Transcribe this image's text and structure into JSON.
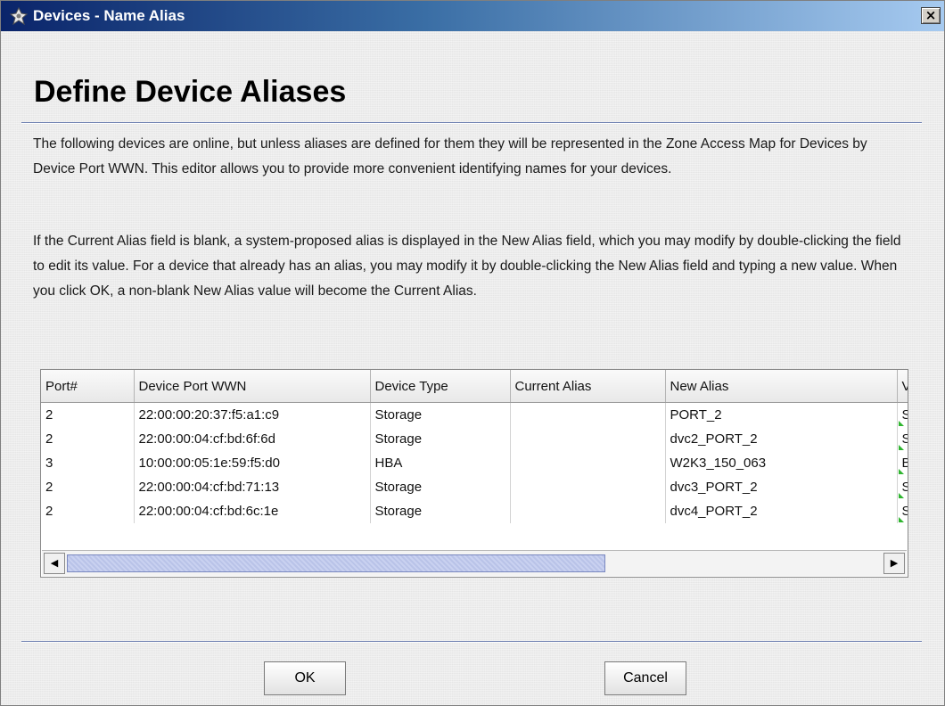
{
  "window": {
    "title": "Devices - Name Alias",
    "close_label": "×"
  },
  "heading": "Define Device Aliases",
  "paragraphs": [
    "The following devices are online, but unless aliases are defined for them they will be represented in the Zone Access Map for Devices by Device Port WWN. This editor allows you to provide more convenient identifying names for your devices.",
    "If the Current Alias field is blank, a system-proposed alias is displayed in the New Alias field, which you may modify by double-clicking the field to edit its value. For a device that already has an alias, you may modify it by double-clicking the New Alias field and typing a new value. When you click OK, a non-blank New Alias value will become the Current Alias."
  ],
  "table": {
    "columns": [
      "Port#",
      "Device Port WWN",
      "Device Type",
      "Current Alias",
      "New Alias",
      "V"
    ],
    "rows": [
      [
        "2",
        "22:00:00:20:37:f5:a1:c9",
        "Storage",
        "",
        "PORT_2",
        "S"
      ],
      [
        "2",
        "22:00:00:04:cf:bd:6f:6d",
        "Storage",
        "",
        "dvc2_PORT_2",
        "S"
      ],
      [
        "3",
        "10:00:00:05:1e:59:f5:d0",
        "HBA",
        "",
        "W2K3_150_063",
        "B"
      ],
      [
        "2",
        "22:00:00:04:cf:bd:71:13",
        "Storage",
        "",
        "dvc3_PORT_2",
        "S"
      ],
      [
        "2",
        "22:00:00:04:cf:bd:6c:1e",
        "Storage",
        "",
        "dvc4_PORT_2",
        "S"
      ]
    ]
  },
  "scrollbar": {
    "left_arrow": "◀",
    "right_arrow": "▶",
    "position_fraction": 0.0,
    "visible_fraction": 0.66
  },
  "buttons": {
    "ok": "OK",
    "cancel": "Cancel"
  },
  "colors": {
    "title_bar_start": "#0a246a",
    "title_bar_end": "#a6caf0",
    "editable_marker": "#2fb52f",
    "scroll_thumb": "#c9d1f0"
  },
  "icons": {
    "app": "devices-icon",
    "close": "close-icon"
  }
}
